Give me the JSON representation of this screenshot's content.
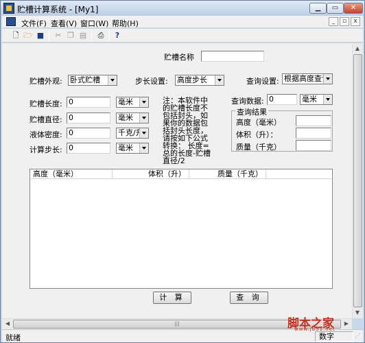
{
  "window": {
    "title": "贮槽计算系统 - [My1]"
  },
  "menu": {
    "items": [
      "文件(F)",
      "查看(V)",
      "窗口(W)",
      "帮助(H)"
    ]
  },
  "form": {
    "name_label": "贮槽名称",
    "name_value": "",
    "shape_label": "贮槽外观:",
    "shape_value": "卧式贮槽",
    "step_setting_label": "步长设置:",
    "step_setting_value": "高度步长",
    "query_setting_label": "查询设置:",
    "query_setting_value": "根据高度查询",
    "length_label": "贮槽长度:",
    "length_value": "0",
    "length_unit": "毫米",
    "diameter_label": "贮槽直径:",
    "diameter_value": "0",
    "diameter_unit": "毫米",
    "density_label": "液体密度:",
    "density_value": "0",
    "density_unit": "千克/升",
    "step_label": "计算步长:",
    "step_value": "0",
    "step_unit": "毫米",
    "note": "注：本软件中的贮槽长度不包括封头，如果你的数据包括封头长度，请按如下公式转换：\n长度=总的长度-贮槽直径/2",
    "query_data_label": "查询数据:",
    "query_data_value": "0",
    "query_data_unit": "毫米",
    "result_group_title": "查询结果",
    "result_height_label": "高度（毫米）",
    "result_volume_label": "体积（升）：",
    "result_mass_label": "质量（千克）"
  },
  "table": {
    "columns": [
      "高度（毫米）",
      "体积（升）",
      "质量（千克）"
    ],
    "rows": []
  },
  "buttons": {
    "calculate": "计 算",
    "query": "查 询"
  },
  "status": {
    "left": "就绪",
    "right": "数字"
  },
  "watermark": {
    "text": "脚本之家",
    "url": "www.jb51.net"
  }
}
